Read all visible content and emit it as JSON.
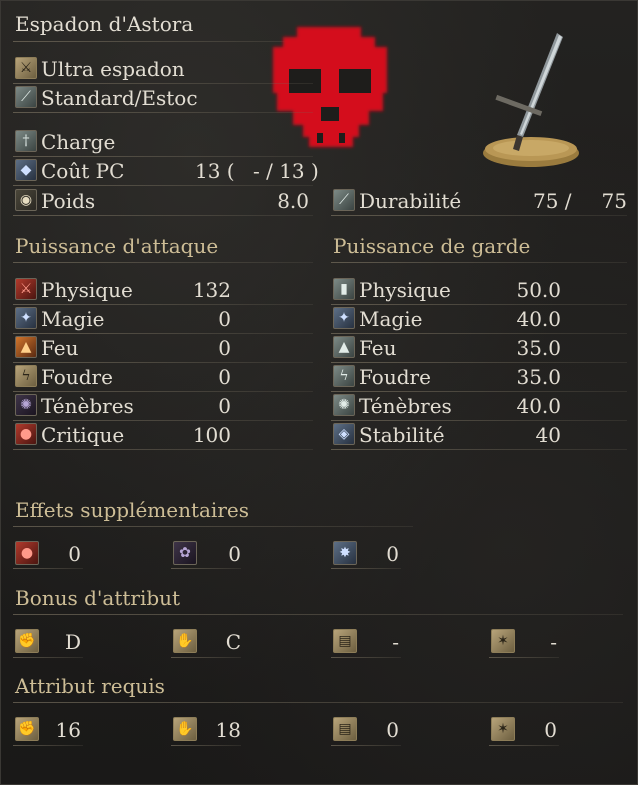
{
  "weapon": {
    "name": "Espadon d'Astora",
    "weapon_type": "Ultra espadon",
    "attack_type": "Standard/Estoc",
    "skill": "Charge",
    "fp_cost_label": "Coût PC",
    "fp_cost_a": "13 (",
    "fp_cost_b": "- / 13 )",
    "weight_label": "Poids",
    "weight_value": "8.0",
    "durability_label": "Durabilité",
    "durability_current": "75 /",
    "durability_max": "75"
  },
  "attack": {
    "title": "Puissance d'attaque",
    "rows": [
      {
        "label": "Physique",
        "value": "132",
        "icon": "physical-attack-icon"
      },
      {
        "label": "Magie",
        "value": "0",
        "icon": "magic-attack-icon"
      },
      {
        "label": "Feu",
        "value": "0",
        "icon": "fire-attack-icon"
      },
      {
        "label": "Foudre",
        "value": "0",
        "icon": "lightning-attack-icon"
      },
      {
        "label": "Ténèbres",
        "value": "0",
        "icon": "dark-attack-icon"
      },
      {
        "label": "Critique",
        "value": "100",
        "icon": "critical-icon"
      }
    ]
  },
  "guard": {
    "title": "Puissance de garde",
    "rows": [
      {
        "label": "Physique",
        "value": "50.0",
        "icon": "physical-guard-icon"
      },
      {
        "label": "Magie",
        "value": "40.0",
        "icon": "magic-guard-icon"
      },
      {
        "label": "Feu",
        "value": "35.0",
        "icon": "fire-guard-icon"
      },
      {
        "label": "Foudre",
        "value": "35.0",
        "icon": "lightning-guard-icon"
      },
      {
        "label": "Ténèbres",
        "value": "40.0",
        "icon": "dark-guard-icon"
      },
      {
        "label": "Stabilité",
        "value": "40",
        "icon": "stability-icon"
      }
    ]
  },
  "effects": {
    "title": "Effets supplémentaires",
    "items": [
      {
        "value": "0",
        "icon": "bleed-icon"
      },
      {
        "value": "0",
        "icon": "poison-icon"
      },
      {
        "value": "0",
        "icon": "frost-icon"
      }
    ]
  },
  "scaling": {
    "title": "Bonus d'attribut",
    "items": [
      {
        "value": "D",
        "icon": "strength-icon"
      },
      {
        "value": "C",
        "icon": "dexterity-icon"
      },
      {
        "value": "-",
        "icon": "intelligence-icon"
      },
      {
        "value": "-",
        "icon": "faith-icon"
      }
    ]
  },
  "requirements": {
    "title": "Attribut requis",
    "items": [
      {
        "value": "16",
        "icon": "strength-icon"
      },
      {
        "value": "18",
        "icon": "dexterity-icon"
      },
      {
        "value": "0",
        "icon": "intelligence-icon"
      },
      {
        "value": "0",
        "icon": "faith-icon"
      }
    ]
  },
  "colors": {
    "skull": "#d4101a",
    "section_title": "#cdbd96"
  }
}
